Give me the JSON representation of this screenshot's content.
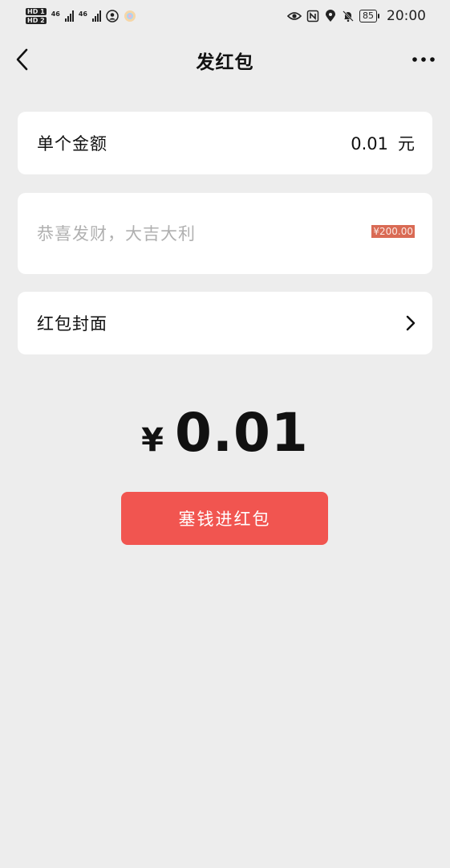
{
  "status_bar": {
    "hd1": "HD 1",
    "hd2": "HD 2",
    "net1": "46",
    "net2": "46",
    "battery": "85",
    "time": "20:00"
  },
  "nav": {
    "title": "发红包"
  },
  "amount_row": {
    "label": "单个金额",
    "value": "0.01",
    "unit": "元"
  },
  "message_row": {
    "placeholder": "恭喜发财，大吉大利",
    "value": "",
    "tag": "¥200.00"
  },
  "cover_row": {
    "label": "红包封面"
  },
  "total": {
    "currency": "¥",
    "value": "0.01"
  },
  "submit": {
    "label": "塞钱进红包"
  },
  "colors": {
    "background": "#ededed",
    "button": "#f15550",
    "tag": "#d96a54"
  }
}
